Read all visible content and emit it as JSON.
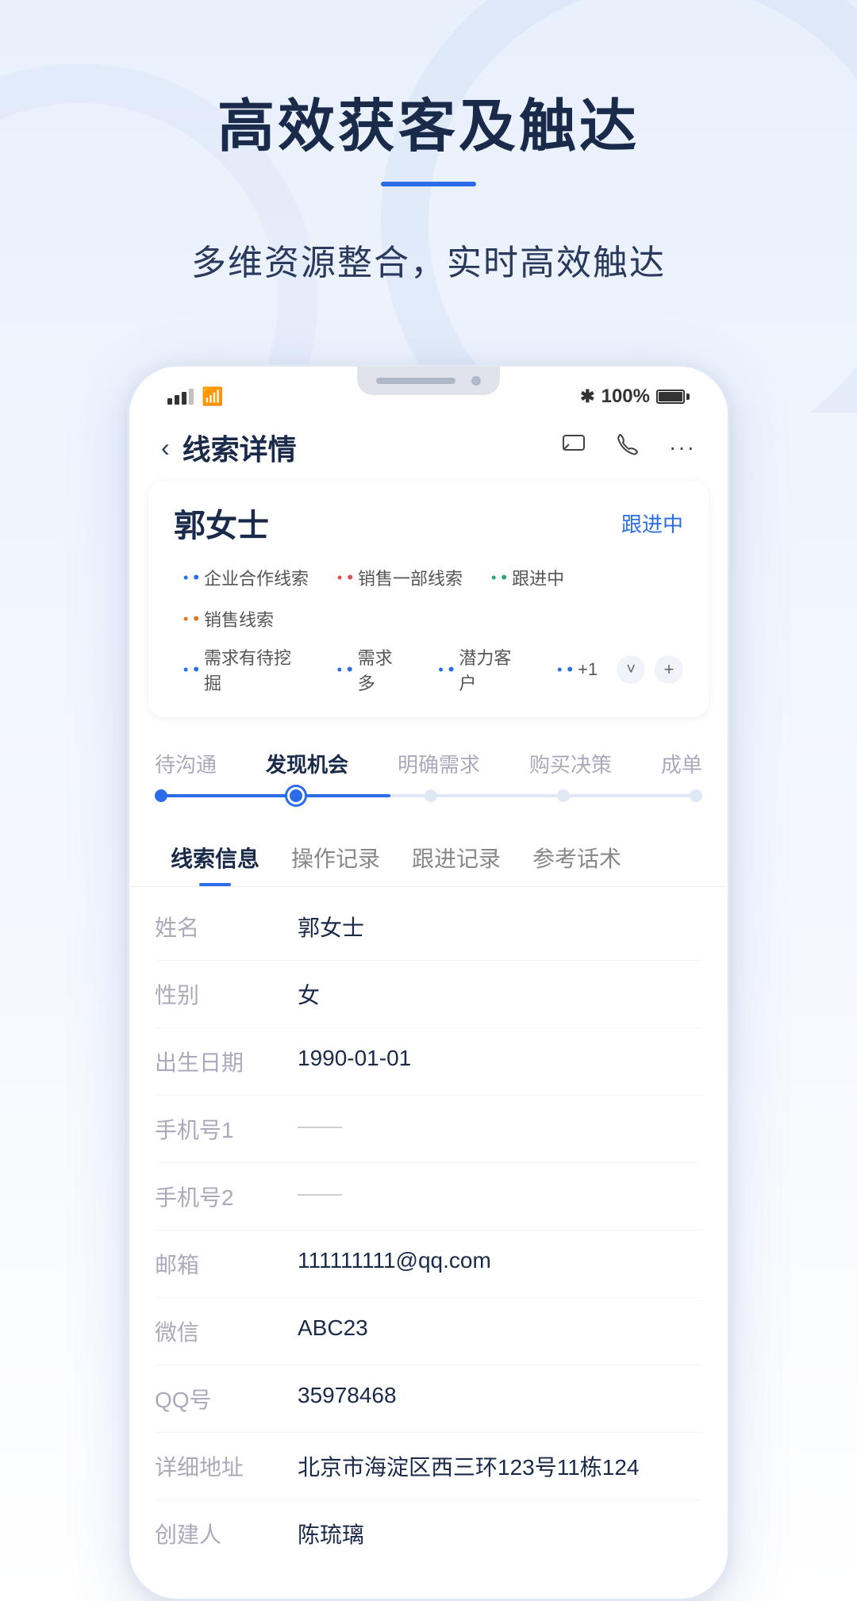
{
  "page": {
    "background_top": "#e8f0fb",
    "background_bottom": "#ffffff"
  },
  "hero": {
    "title": "高效获客及触达",
    "underline_color": "#2b6de8",
    "subtitle": "多维资源整合，实时高效触达"
  },
  "status_bar": {
    "battery_percent": "100%",
    "bluetooth_symbol": "✱"
  },
  "nav": {
    "back_icon": "‹",
    "title": "线索详情",
    "icon_message": "⊡",
    "icon_phone": "✆",
    "icon_more": "···"
  },
  "contact": {
    "name": "郭女士",
    "status": "跟进中",
    "tags": [
      {
        "text": "企业合作线索",
        "color": "blue"
      },
      {
        "text": "销售一部线索",
        "color": "red"
      },
      {
        "text": "跟进中",
        "color": "green"
      },
      {
        "text": "销售线索",
        "color": "orange"
      }
    ],
    "tags2": [
      {
        "text": "需求有待挖掘",
        "color": "blue"
      },
      {
        "text": "需求多",
        "color": "blue"
      },
      {
        "text": "潜力客户",
        "color": "blue"
      },
      {
        "text": "+1",
        "color": "blue"
      }
    ]
  },
  "steps": {
    "items": [
      {
        "label": "待沟通",
        "state": "passed"
      },
      {
        "label": "发现机会",
        "state": "active"
      },
      {
        "label": "明确需求",
        "state": "future"
      },
      {
        "label": "购买决策",
        "state": "future"
      },
      {
        "label": "成单",
        "state": "future"
      }
    ]
  },
  "tabs": [
    {
      "label": "线索信息",
      "active": true
    },
    {
      "label": "操作记录",
      "active": false
    },
    {
      "label": "跟进记录",
      "active": false
    },
    {
      "label": "参考话术",
      "active": false
    }
  ],
  "info_fields": [
    {
      "label": "姓名",
      "value": "郭女士",
      "dash": false
    },
    {
      "label": "性别",
      "value": "女",
      "dash": false
    },
    {
      "label": "出生日期",
      "value": "1990-01-01",
      "dash": false
    },
    {
      "label": "手机号1",
      "value": "——",
      "dash": true
    },
    {
      "label": "手机号2",
      "value": "——",
      "dash": true
    },
    {
      "label": "邮箱",
      "value": "111111111@qq.com",
      "dash": false
    },
    {
      "label": "微信",
      "value": "ABC23",
      "dash": false
    },
    {
      "label": "QQ号",
      "value": "35978468",
      "dash": false
    },
    {
      "label": "详细地址",
      "value": "北京市海淀区西三环123号11栋124",
      "dash": false
    },
    {
      "label": "创建人",
      "value": "陈琉璃",
      "dash": false
    }
  ]
}
